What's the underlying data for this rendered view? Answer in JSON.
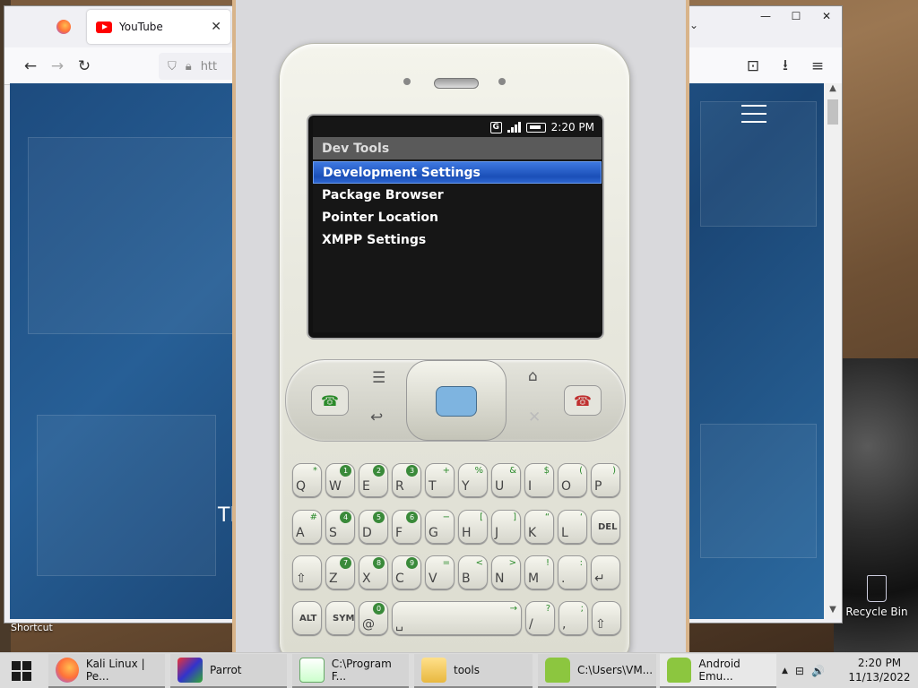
{
  "desktop": {
    "recycle_bin_label": "Recycle Bin",
    "shortcut_label": "Shortcut"
  },
  "firefox": {
    "tabs": [
      {
        "icon": "firefox-icon",
        "title": ""
      },
      {
        "icon": "youtube-icon",
        "title": "YouTube",
        "close": "✕"
      }
    ],
    "tab_list": "⌄",
    "window_controls": {
      "minimize": "—",
      "maximize": "☐",
      "close": "✕"
    },
    "nav": {
      "back": "←",
      "forward": "→",
      "reload": "↻",
      "url_partial": "htt",
      "pocket": "⊡",
      "download": "⭳",
      "menu": "≡"
    },
    "content_text": "Tl"
  },
  "emulator": {
    "status_bar": {
      "notification": "G",
      "time": "2:20 PM"
    },
    "app_title": "Dev Tools",
    "menu_items": [
      {
        "label": "Development Settings",
        "selected": true
      },
      {
        "label": "Package Browser",
        "selected": false
      },
      {
        "label": "Pointer Location",
        "selected": false
      },
      {
        "label": "XMPP Settings",
        "selected": false
      }
    ],
    "keyboard": {
      "row1": [
        [
          "Q",
          "*"
        ],
        [
          "W",
          "1"
        ],
        [
          "E",
          "2"
        ],
        [
          "R",
          "3"
        ],
        [
          "T",
          "+"
        ],
        [
          "Y",
          "%"
        ],
        [
          "U",
          "&"
        ],
        [
          "I",
          "$"
        ],
        [
          "O",
          "("
        ],
        [
          "P",
          ")"
        ]
      ],
      "row2": [
        [
          "A",
          "#"
        ],
        [
          "S",
          "4"
        ],
        [
          "D",
          "5"
        ],
        [
          "F",
          "6"
        ],
        [
          "G",
          "−"
        ],
        [
          "H",
          "["
        ],
        [
          "J",
          "]"
        ],
        [
          "K",
          "“"
        ],
        [
          "L",
          "‘"
        ],
        [
          "DEL",
          ""
        ]
      ],
      "row3": [
        [
          "⇧",
          ""
        ],
        [
          "Z",
          "7"
        ],
        [
          "X",
          "8"
        ],
        [
          "C",
          "9"
        ],
        [
          "V",
          "="
        ],
        [
          "B",
          "<"
        ],
        [
          "N",
          ">"
        ],
        [
          "M",
          "!"
        ],
        [
          ".",
          ":"
        ],
        [
          "↵",
          ""
        ]
      ],
      "row4": [
        [
          "ALT",
          ""
        ],
        [
          "SYM",
          ""
        ],
        [
          "@",
          "0"
        ],
        [
          "␣",
          "→"
        ],
        [
          "/",
          "?"
        ],
        [
          ",",
          ";"
        ],
        [
          "⇧",
          ""
        ]
      ]
    }
  },
  "taskbar": {
    "items": [
      {
        "label": "Kali Linux | Pe...",
        "icon": "firefox-icon"
      },
      {
        "label": "Parrot",
        "icon": "parrot-icon"
      },
      {
        "label": "C:\\Program F...",
        "icon": "notepad-icon"
      },
      {
        "label": "tools",
        "icon": "folder-icon"
      },
      {
        "label": "C:\\Users\\VM...",
        "icon": "android-icon"
      },
      {
        "label": "Android Emu...",
        "icon": "android-icon"
      }
    ],
    "tray": {
      "chevron": "▲",
      "network": "⊟",
      "volume": "🔊"
    },
    "clock": {
      "time": "2:20 PM",
      "date": "11/13/2022"
    }
  }
}
